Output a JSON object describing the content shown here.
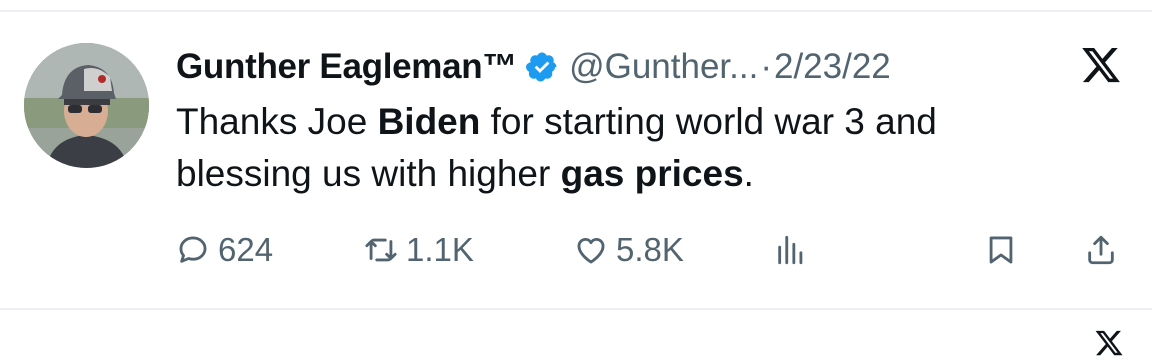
{
  "tweet": {
    "display_name": "Gunther Eagleman™",
    "handle": "@Gunther...",
    "separator": "·",
    "date": "2/23/22",
    "text_line1_a": "Thanks Joe ",
    "text_line1_b": "Biden",
    "text_line1_c": " for starting world war 3 and",
    "text_line2_a": "blessing us with higher ",
    "text_line2_b": "gas prices",
    "text_line2_c": ".",
    "verified": true
  },
  "stats": {
    "replies": "624",
    "retweets": "1.1K",
    "likes": "5.8K"
  },
  "icons": {
    "verified": "verified-badge-icon",
    "platform": "x-logo-icon",
    "reply": "reply-bubble-icon",
    "retweet": "retweet-arrows-icon",
    "like": "heart-icon",
    "views": "views-bars-icon",
    "bookmark": "bookmark-icon",
    "share": "share-upload-icon"
  },
  "colors": {
    "verified_blue": "#1d9bf0",
    "muted_gray": "#536471",
    "text": "#0f1419",
    "divider": "#eceff1"
  }
}
